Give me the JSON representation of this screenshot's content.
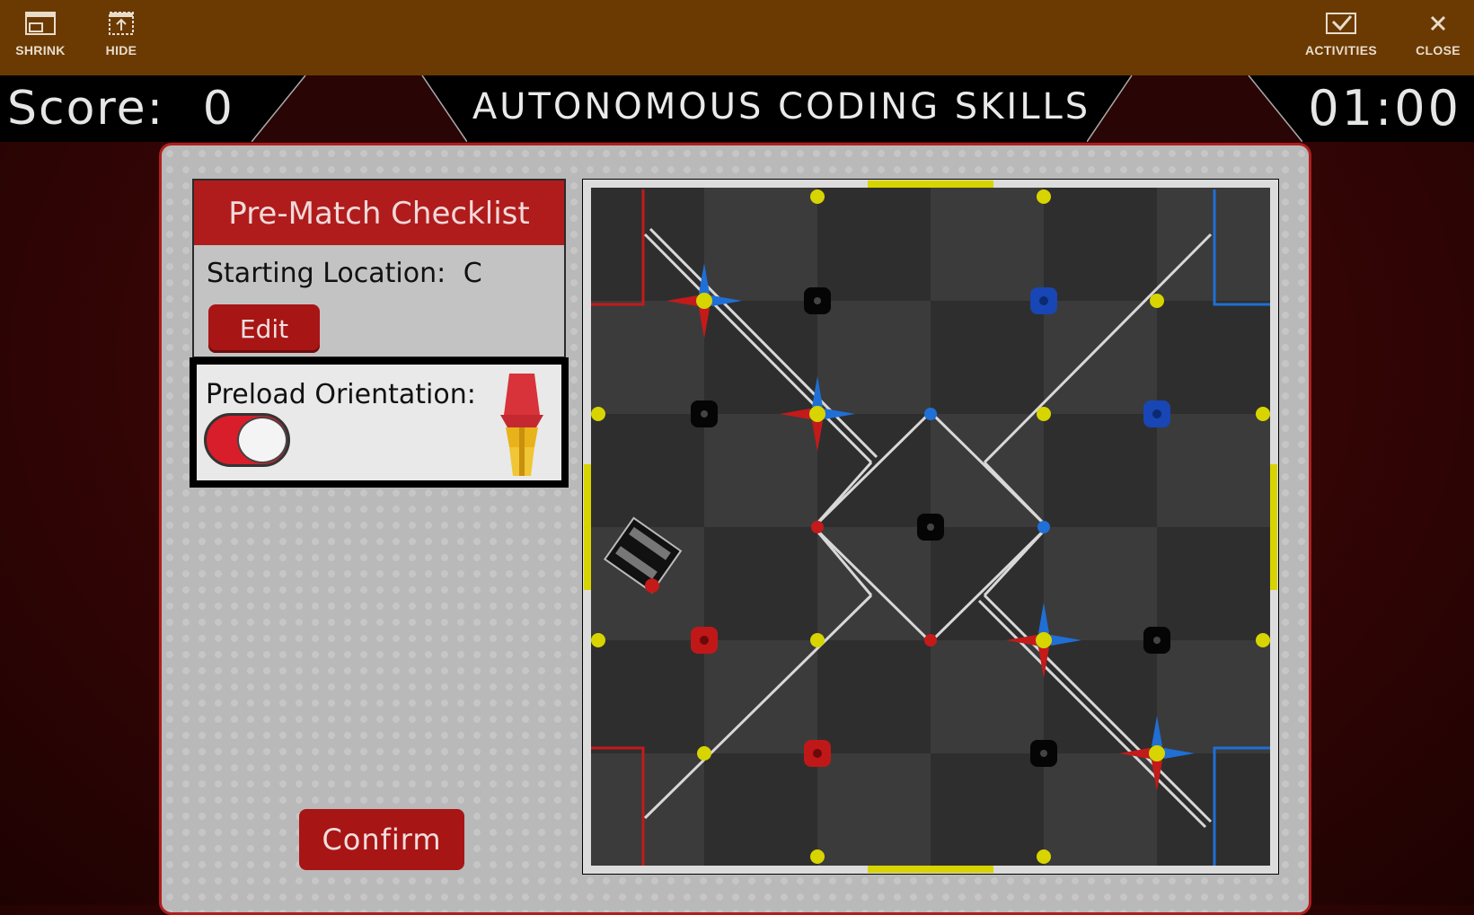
{
  "toolbar": {
    "shrink_label": "SHRINK",
    "hide_label": "HIDE",
    "activities_label": "ACTIVITIES",
    "close_label": "CLOSE"
  },
  "header": {
    "score_label": "Score:",
    "score_value": "0",
    "title": "AUTONOMOUS CODING SKILLS",
    "timer": "01:00"
  },
  "checklist": {
    "title": "Pre-Match Checklist",
    "starting_location_label": "Starting Location:",
    "starting_location_value": "C",
    "edit_label": "Edit",
    "preload_label": "Preload Orientation:",
    "preload_toggle_on": true,
    "confirm_label": "Confirm"
  },
  "colors": {
    "toolbar_bg": "#6b3a02",
    "accent_red": "#b01c1c",
    "alliance_red": "#c41a1a",
    "alliance_blue": "#1f6fd6",
    "goal_yellow": "#d8d400"
  },
  "icons": {
    "shrink": "window-shrink-icon",
    "hide": "window-hide-icon",
    "activities": "checkmark-box-icon",
    "close": "close-icon",
    "preload": "cone-icon"
  }
}
